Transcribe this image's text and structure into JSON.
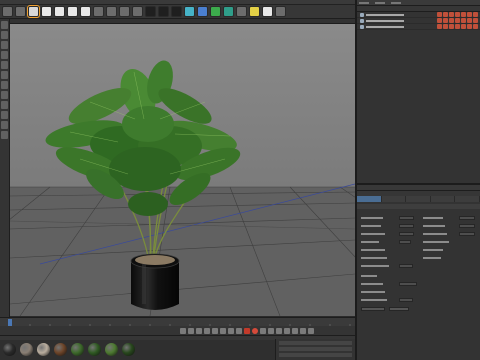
{
  "viewport": {
    "floor_color": "#626262",
    "sky_color": "#7d7d7d",
    "grid_color": "#3d3d3d"
  },
  "toolbar": {
    "icons": [
      "undo-icon",
      "redo-icon",
      "live-select-icon",
      "move-icon",
      "scale-icon",
      "rotate-icon",
      "recent-tools-icon",
      "x-axis-icon",
      "y-axis-icon",
      "z-axis-icon",
      "world-coordinates-icon",
      "render-view-icon",
      "render-picture-viewer-icon",
      "edit-render-settings-icon",
      "cube-icon",
      "spline-pen-icon",
      "subdivision-surface-icon",
      "array-icon",
      "deformer-icon",
      "floor-icon",
      "camera-icon",
      "light-icon"
    ]
  },
  "object_manager": {
    "rows": [
      {
        "name": ""
      },
      {
        "name": ""
      },
      {
        "name": ""
      }
    ]
  },
  "attribute_manager": {
    "tabs": [
      "",
      "",
      "",
      "",
      ""
    ],
    "active_tab": 0
  },
  "materials": {
    "swatches": [
      {
        "color": "#2a2a2a"
      },
      {
        "color": "#8a7f74"
      },
      {
        "color": "#b9ad9e"
      },
      {
        "color": "#6d4428"
      },
      {
        "color": "#3d6a2a"
      },
      {
        "color": "#2f5a22"
      },
      {
        "color": "#4d7a30"
      },
      {
        "color": "#27471c"
      }
    ]
  },
  "colors": {
    "accent": "#e0842c",
    "selection": "#4a6d93",
    "record": "#c23a2a"
  }
}
